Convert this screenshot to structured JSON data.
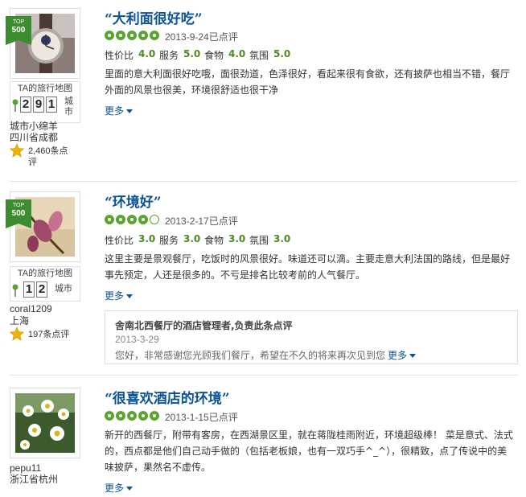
{
  "colors": {
    "link": "#0b5394",
    "rating_green": "#5aa531",
    "score_green": "#4b8a21",
    "badge_green": "#3d8c2f"
  },
  "badge": {
    "top_label": "TOP",
    "rank": "500"
  },
  "map_title": "TA的旅行地图",
  "city_label": "城市",
  "more_label": "更多",
  "score_labels": {
    "value": "性价比",
    "service": "服务",
    "food": "食物",
    "atmosphere": "氛围"
  },
  "reviews": [
    {
      "title": "“大利面很好吃”",
      "rating_bubbles": 5,
      "date": "2013-9-24已点评",
      "scores": {
        "value": "4.0",
        "service": "5.0",
        "food": "4.0",
        "atmosphere": "5.0"
      },
      "text": "里面的意大利面很好吃哦，面很劲道，色泽很好，看起来很有食欲，还有披萨也相当不错，餐厅外面的风景也很美，环境很舒适也很干净",
      "user": {
        "name": "城市小绵羊",
        "location": "四川省成都",
        "review_count": "2,460条点评",
        "map_digits": [
          "2",
          "9",
          "1"
        ]
      }
    },
    {
      "title": "“环境好”",
      "rating_bubbles": 4,
      "date": "2013-2-17已点评",
      "scores": {
        "value": "3.0",
        "service": "3.0",
        "food": "3.0",
        "atmosphere": "3.0"
      },
      "text": "这里主要是景观餐厅，吃饭时的风景很好。味道还可以滴。主要走意大利法国的路线，但是最好事先预定，人还是很多的。不亏是排名比较考前的人气餐厅。",
      "user": {
        "name": "coral1209",
        "location": "上海",
        "review_count": "197条点评",
        "map_digits": [
          "1",
          "2"
        ]
      },
      "response": {
        "title": "舍南北西餐厅的酒店管理者,负责此条点评",
        "date": "2013-3-29",
        "text": "您好，非常感谢您光顾我们餐厅，希望在不久的将来再次见到您"
      }
    },
    {
      "title": "“很喜欢酒店的环境”",
      "rating_bubbles": 5,
      "date": "2013-1-15已点评",
      "text": "新开的西餐厅，附带有客房，在西湖景区里，就在蒋陇桂雨附近，环境超级棒！ 菜是意式、法式的，西点都是他们自己动手做的（包括老板娘，也有一双巧手^_^），很精致，点了传说中的美味披萨，果然名不虚传。",
      "user": {
        "name": "pepu11",
        "location": "浙江省杭州"
      }
    }
  ]
}
